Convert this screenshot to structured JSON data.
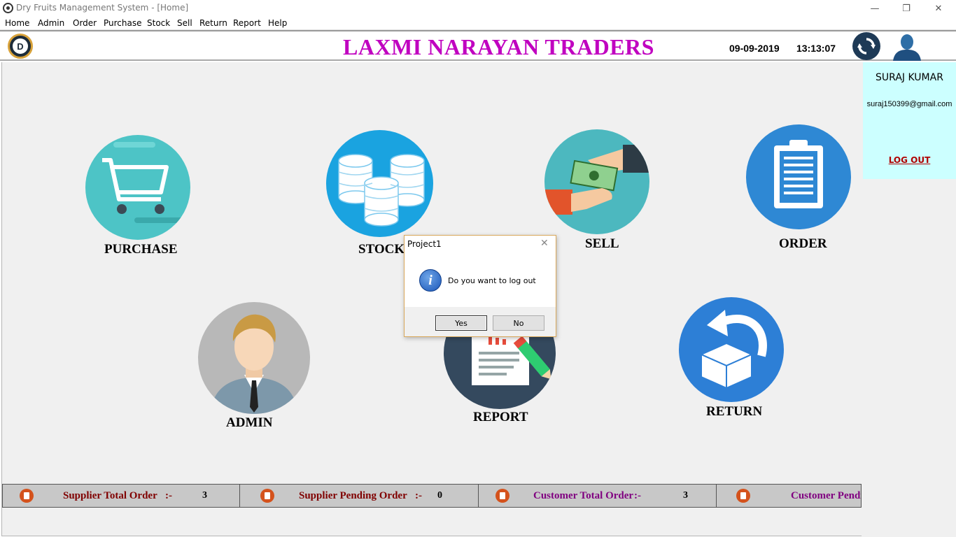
{
  "window": {
    "title": "Dry Fruits Management System - [Home]",
    "minimize_glyph": "—",
    "restore_glyph": "❐",
    "close_glyph": "✕"
  },
  "menu": [
    "Home",
    "Admin",
    "Order",
    "Purchase",
    "Stock",
    "Sell",
    "Return",
    "Report",
    "Help"
  ],
  "header": {
    "logo_letter": "D",
    "company_name": "LAXMI NARAYAN TRADERS",
    "date": "09-09-2019",
    "time": "13:13:07"
  },
  "user": {
    "name": "SURAJ KUMAR",
    "email": "suraj150399@gmail.com",
    "logout_label": "LOG OUT"
  },
  "tiles": {
    "purchase": "PURCHASE",
    "stock": "STOCK",
    "sell": "SELL",
    "order": "ORDER",
    "admin": "ADMIN",
    "report": "REPORT",
    "return": "RETURN"
  },
  "status": [
    {
      "label": "Supplier Total Order",
      "sep": ":-",
      "value": "3",
      "color": "#800000"
    },
    {
      "label": "Supplier Pending Order",
      "sep": ":-",
      "value": "0",
      "color": "#800000"
    },
    {
      "label": "Customer Total Order",
      "sep": ":-",
      "value": "3",
      "color": "#800080"
    },
    {
      "label": "Customer Pendi",
      "sep": "",
      "value": "",
      "color": "#800080"
    }
  ],
  "dialog": {
    "title": "Project1",
    "close_glyph": "✕",
    "info_glyph": "i",
    "message": "Do you want to log out",
    "yes_label": "Yes",
    "no_label": "No"
  },
  "colors": {
    "company_title": "#c000c0",
    "user_panel": "#ccffff",
    "logout": "#b00000"
  }
}
